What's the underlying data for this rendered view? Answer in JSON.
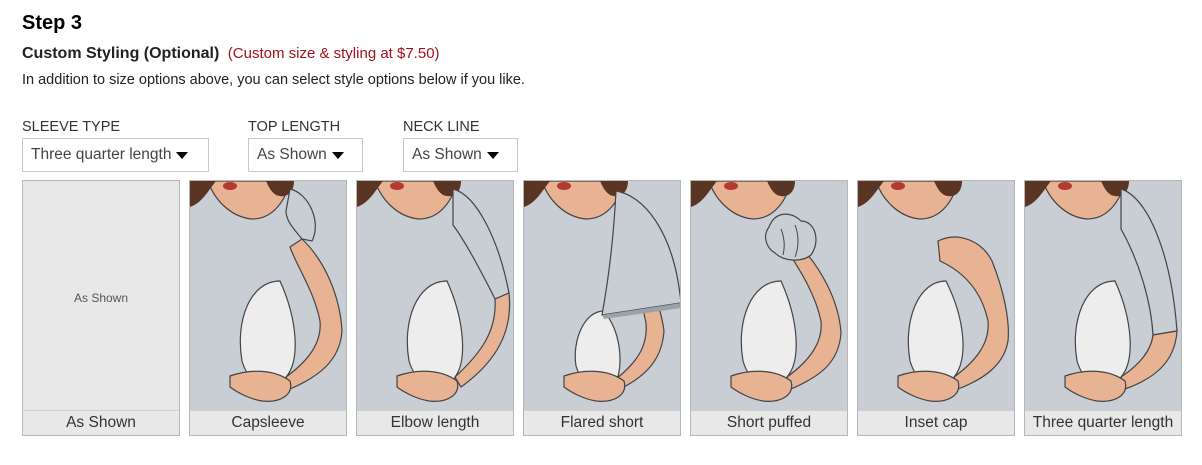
{
  "step": {
    "title": "Step 3",
    "heading": "Custom Styling (Optional)",
    "price_note": "(Custom size & styling at $7.50)",
    "description": "In addition to size options above, you can select style options below if you like."
  },
  "selects": [
    {
      "label": "SLEEVE TYPE",
      "value": "Three quarter length"
    },
    {
      "label": "TOP LENGTH",
      "value": "As Shown"
    },
    {
      "label": "NECK LINE",
      "value": "As Shown"
    }
  ],
  "sleeve_options": [
    {
      "caption": "As Shown",
      "inner_label": "As Shown"
    },
    {
      "caption": "Capsleeve"
    },
    {
      "caption": "Elbow length"
    },
    {
      "caption": "Flared short"
    },
    {
      "caption": "Short puffed"
    },
    {
      "caption": "Inset cap"
    },
    {
      "caption": "Three quarter length"
    }
  ],
  "colors": {
    "price": "#a0121c",
    "tile_bg": "#e8e8e8",
    "shirt": "#c8ced4",
    "skin": "#e8b393",
    "hair": "#5a3524",
    "lips": "#b33a2e"
  }
}
